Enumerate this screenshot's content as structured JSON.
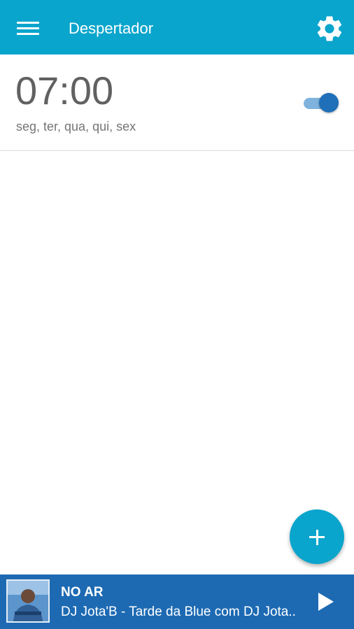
{
  "app_bar": {
    "title": "Despertador",
    "menu_icon": "hamburger-menu-icon",
    "settings_icon": "gear-icon",
    "background_color": "#0aa5cc"
  },
  "alarms": [
    {
      "time": "07:00",
      "days": "seg, ter, qua, qui, sex",
      "enabled": true
    }
  ],
  "fab": {
    "icon": "plus-icon",
    "color": "#0aa5cc"
  },
  "player": {
    "status": "NO AR",
    "track": "DJ Jota'B - Tarde da Blue com DJ Jota..",
    "play_icon": "play-icon",
    "background_color": "#1d6ab3"
  }
}
